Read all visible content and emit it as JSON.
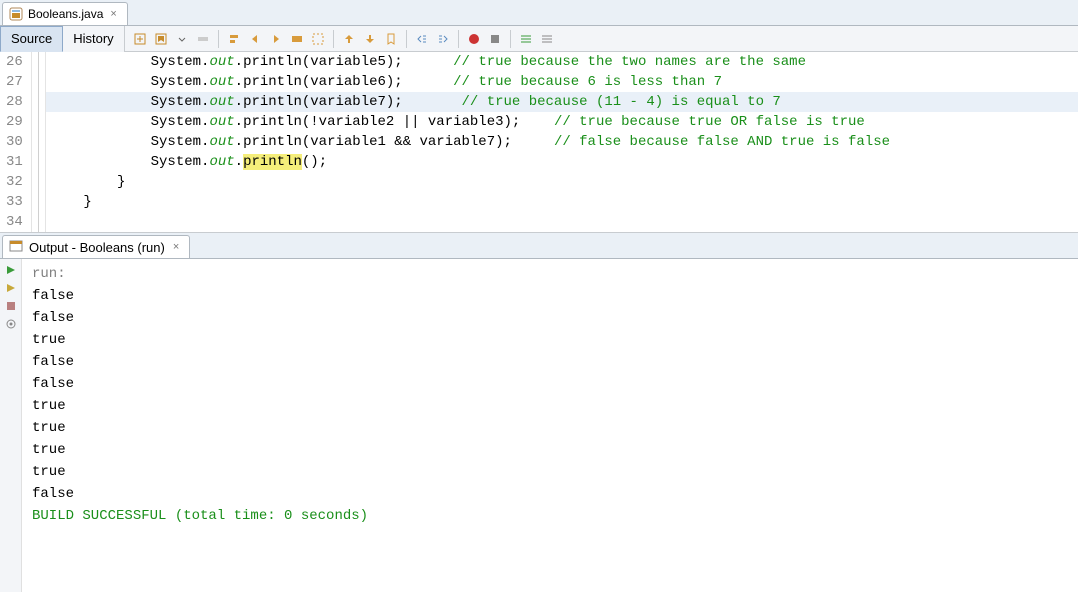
{
  "fileTab": {
    "name": "Booleans.java",
    "close": "×"
  },
  "subTabs": {
    "source": "Source",
    "history": "History"
  },
  "code": {
    "lines": [
      {
        "n": 26,
        "indent": "            ",
        "prefix": "System.",
        "out": "out",
        "mid": ".println(variable5);",
        "pad": "      ",
        "comment": "// true because the two names are the same"
      },
      {
        "n": 27,
        "indent": "            ",
        "prefix": "System.",
        "out": "out",
        "mid": ".println(variable6);",
        "pad": "      ",
        "comment": "// true because 6 is less than 7"
      },
      {
        "n": 28,
        "indent": "            ",
        "prefix": "System.",
        "out": "out",
        "mid": ".println(variable7);",
        "pad": "       ",
        "comment": "// true because (11 - 4) is equal to 7",
        "hl": true
      },
      {
        "n": 29,
        "indent": "            ",
        "prefix": "System.",
        "out": "out",
        "mid": ".println(!variable2 || variable3);",
        "pad": "    ",
        "comment": "// true because true OR false is true"
      },
      {
        "n": 30,
        "indent": "            ",
        "prefix": "System.",
        "out": "out",
        "mid": ".println(variable1 && variable7);",
        "pad": "     ",
        "comment": "// false because false AND true is false"
      },
      {
        "n": 31,
        "indent": "            ",
        "prefix": "System.",
        "out": "out",
        "mid": ".",
        "hlword": "println",
        "tail": "();"
      },
      {
        "n": 32,
        "indent": "        ",
        "plain": "}"
      },
      {
        "n": 33,
        "indent": "    ",
        "plain": "}"
      },
      {
        "n": 34,
        "indent": "",
        "plain": ""
      }
    ]
  },
  "outputTab": {
    "title": "Output - Booleans (run)",
    "close": "×"
  },
  "output": {
    "lines": [
      {
        "text": "run:",
        "cls": "out-gray"
      },
      {
        "text": "false"
      },
      {
        "text": "false"
      },
      {
        "text": "true"
      },
      {
        "text": "false"
      },
      {
        "text": "false"
      },
      {
        "text": "true"
      },
      {
        "text": "true"
      },
      {
        "text": "true"
      },
      {
        "text": "true"
      },
      {
        "text": "false"
      },
      {
        "text": ""
      },
      {
        "text": "BUILD SUCCESSFUL (total time: 0 seconds)",
        "cls": "out-green"
      }
    ]
  }
}
